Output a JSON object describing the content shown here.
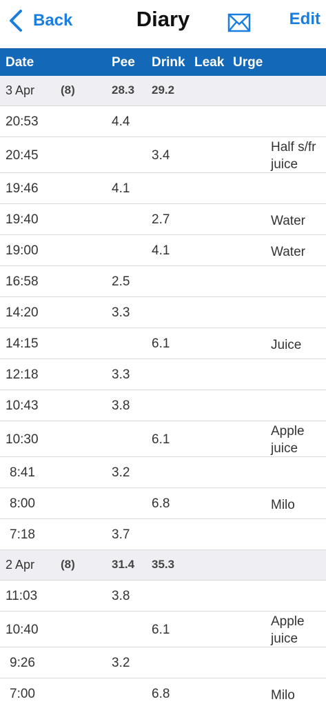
{
  "nav": {
    "back_label": "Back",
    "title": "Diary",
    "edit_label": "Edit"
  },
  "columns": {
    "date": "Date",
    "pee": "Pee",
    "drink": "Drink",
    "leak": "Leak",
    "urge": "Urge"
  },
  "colors": {
    "accent": "#1a7ee0",
    "header_bg": "#1368b8",
    "section_bg": "#efeff3"
  },
  "rows": [
    {
      "type": "section",
      "date": "3 Apr",
      "count": "(8)",
      "pee": "28.3",
      "drink": "29.2"
    },
    {
      "type": "entry",
      "time": "20:53",
      "pee": "4.4",
      "drink": "",
      "note": ""
    },
    {
      "type": "entry",
      "time": "20:45",
      "pee": "",
      "drink": "3.4",
      "note": "Half s/fr juice"
    },
    {
      "type": "entry",
      "time": "19:46",
      "pee": "4.1",
      "drink": "",
      "note": ""
    },
    {
      "type": "entry",
      "time": "19:40",
      "pee": "",
      "drink": "2.7",
      "note": "Water"
    },
    {
      "type": "entry",
      "time": "19:00",
      "pee": "",
      "drink": "4.1",
      "note": "Water"
    },
    {
      "type": "entry",
      "time": "16:58",
      "pee": "2.5",
      "drink": "",
      "note": ""
    },
    {
      "type": "entry",
      "time": "14:20",
      "pee": "3.3",
      "drink": "",
      "note": ""
    },
    {
      "type": "entry",
      "time": "14:15",
      "pee": "",
      "drink": "6.1",
      "note": "Juice"
    },
    {
      "type": "entry",
      "time": "12:18",
      "pee": "3.3",
      "drink": "",
      "note": ""
    },
    {
      "type": "entry",
      "time": "10:43",
      "pee": "3.8",
      "drink": "",
      "note": ""
    },
    {
      "type": "entry",
      "time": "10:30",
      "pee": "",
      "drink": "6.1",
      "note": "Apple juice"
    },
    {
      "type": "entry",
      "time": "8:41",
      "pee": "3.2",
      "drink": "",
      "note": ""
    },
    {
      "type": "entry",
      "time": "8:00",
      "pee": "",
      "drink": "6.8",
      "note": "Milo"
    },
    {
      "type": "entry",
      "time": "7:18",
      "pee": "3.7",
      "drink": "",
      "note": ""
    },
    {
      "type": "section",
      "date": "2 Apr",
      "count": "(8)",
      "pee": "31.4",
      "drink": "35.3"
    },
    {
      "type": "entry",
      "time": "11:03",
      "pee": "3.8",
      "drink": "",
      "note": ""
    },
    {
      "type": "entry",
      "time": "10:40",
      "pee": "",
      "drink": "6.1",
      "note": "Apple juice"
    },
    {
      "type": "entry",
      "time": "9:26",
      "pee": "3.2",
      "drink": "",
      "note": ""
    },
    {
      "type": "entry",
      "time": "7:00",
      "pee": "",
      "drink": "6.8",
      "note": "Milo"
    }
  ]
}
